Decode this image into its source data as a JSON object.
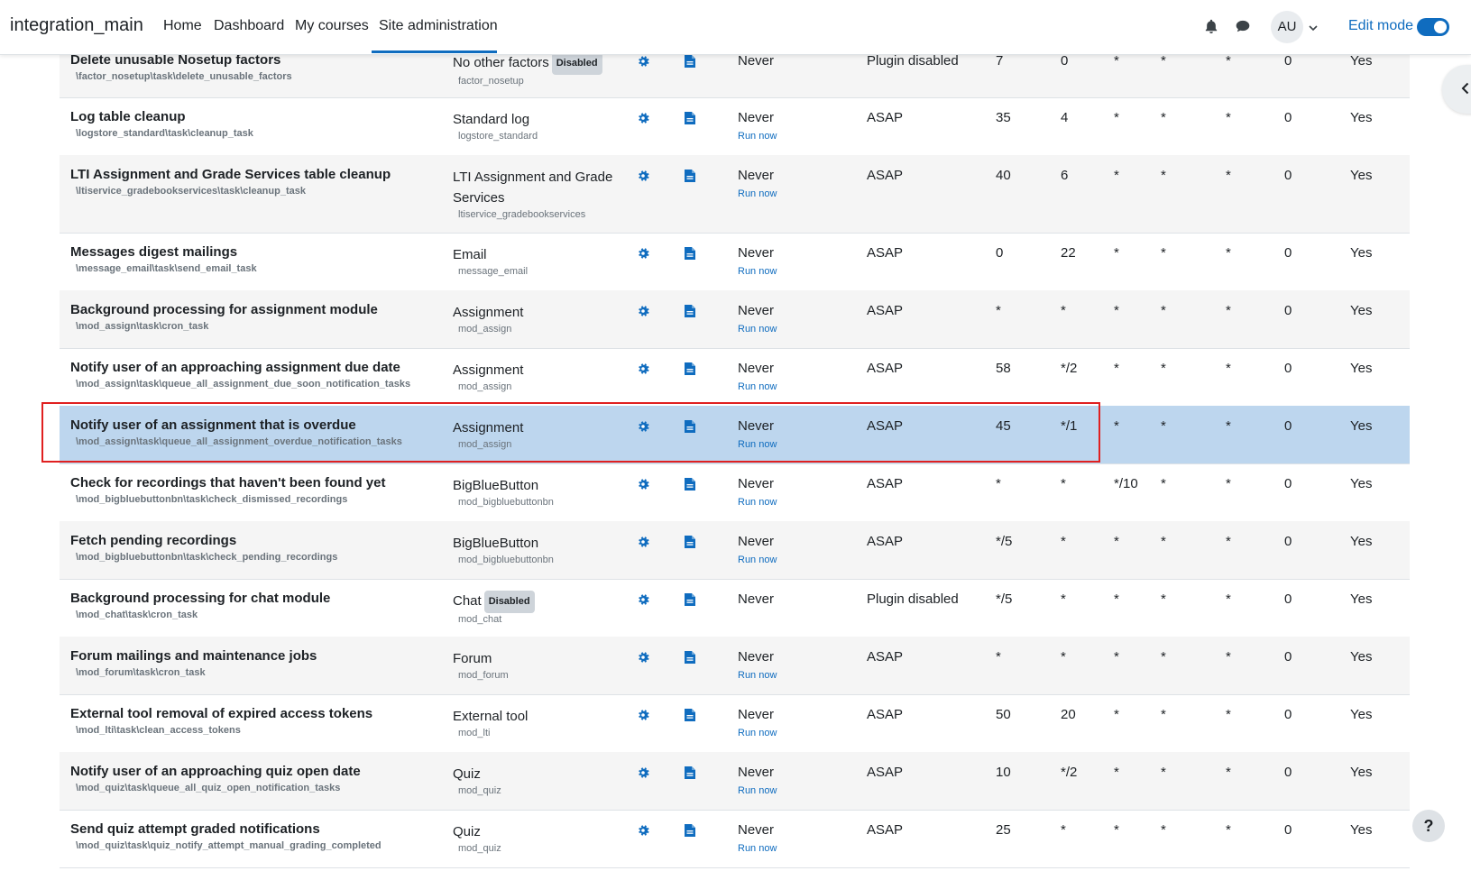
{
  "navbar": {
    "brand": "integration_main",
    "items": [
      {
        "label": "Home"
      },
      {
        "label": "Dashboard"
      },
      {
        "label": "My courses"
      },
      {
        "label": "Site administration"
      }
    ],
    "avatar_initials": "AU",
    "edit_mode_label": "Edit mode",
    "edit_mode_on": true
  },
  "colors": {
    "accent": "#0f6cbf",
    "selected_row": "#bdd6ee",
    "highlight_border": "#e02020"
  },
  "tasks": [
    {
      "name": "Delete unusable Nosetup factors",
      "class": "\\factor_nosetup\\task\\delete_unusable_factors",
      "component": "No other factors",
      "component_badge": "Disabled",
      "component_sub": "factor_nosetup",
      "last_run": "Never",
      "run_now": "",
      "next_run": "Plugin disabled",
      "minute": "7",
      "hour": "0",
      "day": "*",
      "day_of_week": "*",
      "month": "*",
      "fail_delay": "0",
      "default": "Yes"
    },
    {
      "name": "Log table cleanup",
      "class": "\\logstore_standard\\task\\cleanup_task",
      "component": "Standard log",
      "component_badge": "",
      "component_sub": "logstore_standard",
      "last_run": "Never",
      "run_now": "Run now",
      "next_run": "ASAP",
      "minute": "35",
      "hour": "4",
      "day": "*",
      "day_of_week": "*",
      "month": "*",
      "fail_delay": "0",
      "default": "Yes"
    },
    {
      "name": "LTI Assignment and Grade Services table cleanup",
      "class": "\\ltiservice_gradebookservices\\task\\cleanup_task",
      "component": "LTI Assignment and Grade Services",
      "component_badge": "",
      "component_sub": "ltiservice_gradebookservices",
      "last_run": "Never",
      "run_now": "Run now",
      "next_run": "ASAP",
      "minute": "40",
      "hour": "6",
      "day": "*",
      "day_of_week": "*",
      "month": "*",
      "fail_delay": "0",
      "default": "Yes"
    },
    {
      "name": "Messages digest mailings",
      "class": "\\message_email\\task\\send_email_task",
      "component": "Email",
      "component_badge": "",
      "component_sub": "message_email",
      "last_run": "Never",
      "run_now": "Run now",
      "next_run": "ASAP",
      "minute": "0",
      "hour": "22",
      "day": "*",
      "day_of_week": "*",
      "month": "*",
      "fail_delay": "0",
      "default": "Yes"
    },
    {
      "name": "Background processing for assignment module",
      "class": "\\mod_assign\\task\\cron_task",
      "component": "Assignment",
      "component_badge": "",
      "component_sub": "mod_assign",
      "last_run": "Never",
      "run_now": "Run now",
      "next_run": "ASAP",
      "minute": "*",
      "hour": "*",
      "day": "*",
      "day_of_week": "*",
      "month": "*",
      "fail_delay": "0",
      "default": "Yes"
    },
    {
      "name": "Notify user of an approaching assignment due date",
      "class": "\\mod_assign\\task\\queue_all_assignment_due_soon_notification_tasks",
      "component": "Assignment",
      "component_badge": "",
      "component_sub": "mod_assign",
      "last_run": "Never",
      "run_now": "Run now",
      "next_run": "ASAP",
      "minute": "58",
      "hour": "*/2",
      "day": "*",
      "day_of_week": "*",
      "month": "*",
      "fail_delay": "0",
      "default": "Yes"
    },
    {
      "name": "Notify user of an assignment that is overdue",
      "class": "\\mod_assign\\task\\queue_all_assignment_overdue_notification_tasks",
      "component": "Assignment",
      "component_badge": "",
      "component_sub": "mod_assign",
      "last_run": "Never",
      "run_now": "Run now",
      "next_run": "ASAP",
      "minute": "45",
      "hour": "*/1",
      "day": "*",
      "day_of_week": "*",
      "month": "*",
      "fail_delay": "0",
      "default": "Yes"
    },
    {
      "name": "Check for recordings that haven't been found yet",
      "class": "\\mod_bigbluebuttonbn\\task\\check_dismissed_recordings",
      "component": "BigBlueButton",
      "component_badge": "",
      "component_sub": "mod_bigbluebuttonbn",
      "last_run": "Never",
      "run_now": "Run now",
      "next_run": "ASAP",
      "minute": "*",
      "hour": "*",
      "day": "*/10",
      "day_of_week": "*",
      "month": "*",
      "fail_delay": "0",
      "default": "Yes"
    },
    {
      "name": "Fetch pending recordings",
      "class": "\\mod_bigbluebuttonbn\\task\\check_pending_recordings",
      "component": "BigBlueButton",
      "component_badge": "",
      "component_sub": "mod_bigbluebuttonbn",
      "last_run": "Never",
      "run_now": "Run now",
      "next_run": "ASAP",
      "minute": "*/5",
      "hour": "*",
      "day": "*",
      "day_of_week": "*",
      "month": "*",
      "fail_delay": "0",
      "default": "Yes"
    },
    {
      "name": "Background processing for chat module",
      "class": "\\mod_chat\\task\\cron_task",
      "component": "Chat",
      "component_badge": "Disabled",
      "component_sub": "mod_chat",
      "last_run": "Never",
      "run_now": "",
      "next_run": "Plugin disabled",
      "minute": "*/5",
      "hour": "*",
      "day": "*",
      "day_of_week": "*",
      "month": "*",
      "fail_delay": "0",
      "default": "Yes"
    },
    {
      "name": "Forum mailings and maintenance jobs",
      "class": "\\mod_forum\\task\\cron_task",
      "component": "Forum",
      "component_badge": "",
      "component_sub": "mod_forum",
      "last_run": "Never",
      "run_now": "Run now",
      "next_run": "ASAP",
      "minute": "*",
      "hour": "*",
      "day": "*",
      "day_of_week": "*",
      "month": "*",
      "fail_delay": "0",
      "default": "Yes"
    },
    {
      "name": "External tool removal of expired access tokens",
      "class": "\\mod_lti\\task\\clean_access_tokens",
      "component": "External tool",
      "component_badge": "",
      "component_sub": "mod_lti",
      "last_run": "Never",
      "run_now": "Run now",
      "next_run": "ASAP",
      "minute": "50",
      "hour": "20",
      "day": "*",
      "day_of_week": "*",
      "month": "*",
      "fail_delay": "0",
      "default": "Yes"
    },
    {
      "name": "Notify user of an approaching quiz open date",
      "class": "\\mod_quiz\\task\\queue_all_quiz_open_notification_tasks",
      "component": "Quiz",
      "component_badge": "",
      "component_sub": "mod_quiz",
      "last_run": "Never",
      "run_now": "Run now",
      "next_run": "ASAP",
      "minute": "10",
      "hour": "*/2",
      "day": "*",
      "day_of_week": "*",
      "month": "*",
      "fail_delay": "0",
      "default": "Yes"
    },
    {
      "name": "Send quiz attempt graded notifications",
      "class": "\\mod_quiz\\task\\quiz_notify_attempt_manual_grading_completed",
      "component": "Quiz",
      "component_badge": "",
      "component_sub": "mod_quiz",
      "last_run": "Never",
      "run_now": "Run now",
      "next_run": "ASAP",
      "minute": "25",
      "hour": "*",
      "day": "*",
      "day_of_week": "*",
      "month": "*",
      "fail_delay": "0",
      "default": "Yes"
    }
  ],
  "selected_task_index": 6,
  "help_button": "?"
}
